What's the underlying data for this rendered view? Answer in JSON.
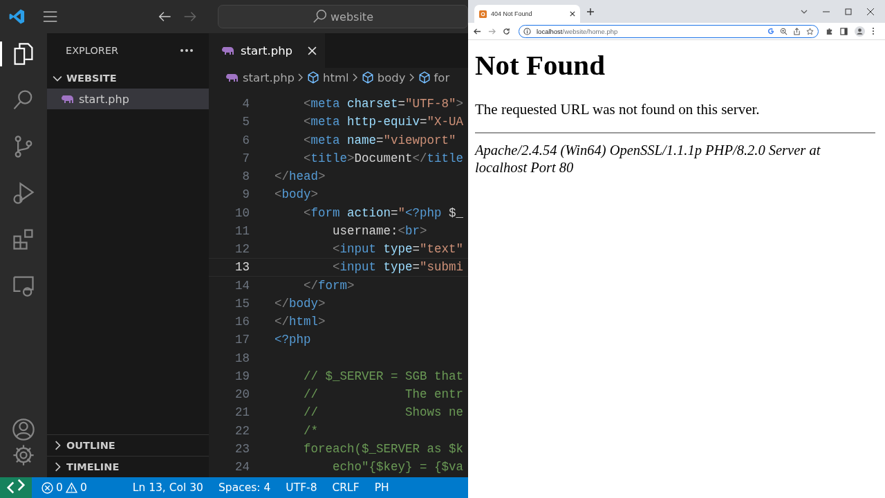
{
  "title_bar": {
    "search": "website"
  },
  "activity_bar": {
    "top": [
      {
        "kind": "explorer",
        "selected": true
      },
      {
        "kind": "search",
        "selected": false
      },
      {
        "kind": "source-control",
        "selected": false
      },
      {
        "kind": "run",
        "selected": false
      },
      {
        "kind": "extensions",
        "selected": false
      },
      {
        "kind": "remote",
        "selected": false
      }
    ],
    "bottom": [
      {
        "kind": "accounts"
      },
      {
        "kind": "manage"
      }
    ]
  },
  "explorer": {
    "title": "EXPLORER",
    "folder": {
      "name": "WEBSITE",
      "expanded": true,
      "files": [
        {
          "name": "start.php",
          "selected": true
        }
      ]
    },
    "sections": [
      {
        "name": "OUTLINE",
        "expanded": false
      },
      {
        "name": "TIMELINE",
        "expanded": false
      }
    ]
  },
  "editor": {
    "tabs": [
      {
        "label": "start.php",
        "selected": true
      }
    ],
    "breadcrumbs": [
      {
        "kind": "file",
        "label": "start.php"
      },
      {
        "kind": "element",
        "label": "html"
      },
      {
        "kind": "element",
        "label": "body"
      },
      {
        "kind": "element",
        "label": "for"
      }
    ],
    "lines": [
      {
        "number": "4",
        "current": false,
        "tokens": [
          {
            "kind": "punct",
            "text": "    <"
          },
          {
            "kind": "tag",
            "text": "meta"
          },
          {
            "kind": "attr",
            "text": " charset"
          },
          {
            "kind": "plain",
            "text": "="
          },
          {
            "kind": "string",
            "text": "\"UTF-8\""
          },
          {
            "kind": "punct",
            "text": ">"
          }
        ]
      },
      {
        "number": "5",
        "current": false,
        "tokens": [
          {
            "kind": "punct",
            "text": "    <"
          },
          {
            "kind": "tag",
            "text": "meta"
          },
          {
            "kind": "attr",
            "text": " http-equiv"
          },
          {
            "kind": "plain",
            "text": "="
          },
          {
            "kind": "string",
            "text": "\"X-UA"
          }
        ]
      },
      {
        "number": "6",
        "current": false,
        "tokens": [
          {
            "kind": "punct",
            "text": "    <"
          },
          {
            "kind": "tag",
            "text": "meta"
          },
          {
            "kind": "attr",
            "text": " name"
          },
          {
            "kind": "plain",
            "text": "="
          },
          {
            "kind": "string",
            "text": "\"viewport\""
          }
        ]
      },
      {
        "number": "7",
        "current": false,
        "tokens": [
          {
            "kind": "punct",
            "text": "    <"
          },
          {
            "kind": "tag",
            "text": "title"
          },
          {
            "kind": "punct",
            "text": ">"
          },
          {
            "kind": "plain",
            "text": "Document"
          },
          {
            "kind": "punct",
            "text": "</"
          },
          {
            "kind": "tag",
            "text": "title"
          }
        ]
      },
      {
        "number": "8",
        "current": false,
        "tokens": [
          {
            "kind": "punct",
            "text": "</"
          },
          {
            "kind": "tag",
            "text": "head"
          },
          {
            "kind": "punct",
            "text": ">"
          }
        ]
      },
      {
        "number": "9",
        "current": false,
        "tokens": [
          {
            "kind": "punct",
            "text": "<"
          },
          {
            "kind": "tag",
            "text": "body"
          },
          {
            "kind": "punct",
            "text": ">"
          }
        ]
      },
      {
        "number": "10",
        "current": false,
        "tokens": [
          {
            "kind": "punct",
            "text": "    <"
          },
          {
            "kind": "tag",
            "text": "form"
          },
          {
            "kind": "attr",
            "text": " action"
          },
          {
            "kind": "plain",
            "text": "="
          },
          {
            "kind": "string",
            "text": "\""
          },
          {
            "kind": "tag",
            "text": "<?php"
          },
          {
            "kind": "plain",
            "text": " $_"
          }
        ]
      },
      {
        "number": "11",
        "current": false,
        "tokens": [
          {
            "kind": "plain",
            "text": "        username:"
          },
          {
            "kind": "punct",
            "text": "<"
          },
          {
            "kind": "tag",
            "text": "br"
          },
          {
            "kind": "punct",
            "text": ">"
          }
        ]
      },
      {
        "number": "12",
        "current": false,
        "tokens": [
          {
            "kind": "punct",
            "text": "        <"
          },
          {
            "kind": "tag",
            "text": "input"
          },
          {
            "kind": "attr",
            "text": " type"
          },
          {
            "kind": "plain",
            "text": "="
          },
          {
            "kind": "string",
            "text": "\"text\""
          }
        ]
      },
      {
        "number": "13",
        "current": true,
        "tokens": [
          {
            "kind": "punct",
            "text": "        <"
          },
          {
            "kind": "tag",
            "text": "input"
          },
          {
            "kind": "attr",
            "text": " type"
          },
          {
            "kind": "plain",
            "text": "="
          },
          {
            "kind": "string",
            "text": "\"submi"
          }
        ]
      },
      {
        "number": "14",
        "current": false,
        "tokens": [
          {
            "kind": "punct",
            "text": "    </"
          },
          {
            "kind": "tag",
            "text": "form"
          },
          {
            "kind": "punct",
            "text": ">"
          }
        ]
      },
      {
        "number": "15",
        "current": false,
        "tokens": [
          {
            "kind": "punct",
            "text": "</"
          },
          {
            "kind": "tag",
            "text": "body"
          },
          {
            "kind": "punct",
            "text": ">"
          }
        ]
      },
      {
        "number": "16",
        "current": false,
        "tokens": [
          {
            "kind": "punct",
            "text": "</"
          },
          {
            "kind": "tag",
            "text": "html"
          },
          {
            "kind": "punct",
            "text": ">"
          }
        ]
      },
      {
        "number": "17",
        "current": false,
        "tokens": [
          {
            "kind": "tag",
            "text": "<?php"
          }
        ]
      },
      {
        "number": "18",
        "current": false
      },
      {
        "number": "19",
        "current": false,
        "tokens": [
          {
            "kind": "comment",
            "text": "    // $_SERVER = SGB that"
          }
        ]
      },
      {
        "number": "20",
        "current": false,
        "tokens": [
          {
            "kind": "comment",
            "text": "    //            The entr"
          }
        ]
      },
      {
        "number": "21",
        "current": false,
        "tokens": [
          {
            "kind": "comment",
            "text": "    //            Shows ne"
          }
        ]
      },
      {
        "number": "22",
        "current": false,
        "tokens": [
          {
            "kind": "comment",
            "text": "    /*"
          }
        ]
      },
      {
        "number": "23",
        "current": false,
        "tokens": [
          {
            "kind": "comment",
            "text": "    foreach($_SERVER as $k"
          }
        ]
      },
      {
        "number": "24",
        "current": false,
        "tokens": [
          {
            "kind": "comment",
            "text": "        echo\"{$key} = {$va"
          }
        ]
      }
    ]
  },
  "status_bar": {
    "errors": "0",
    "warnings": "0",
    "items": [
      "Ln 13, Col 30",
      "Spaces: 4",
      "UTF-8",
      "CRLF",
      "PH"
    ]
  },
  "browser": {
    "tabs": [
      {
        "title": "404 Not Found",
        "selected": true
      }
    ],
    "url": {
      "host": "localhost",
      "path": "/website/home.php"
    },
    "page": {
      "heading": "Not Found",
      "message": "The requested URL was not found on this server.",
      "signature": "Apache/2.4.54 (Win64) OpenSSL/1.1.1p PHP/8.2.0 Server at localhost Port 80"
    }
  }
}
